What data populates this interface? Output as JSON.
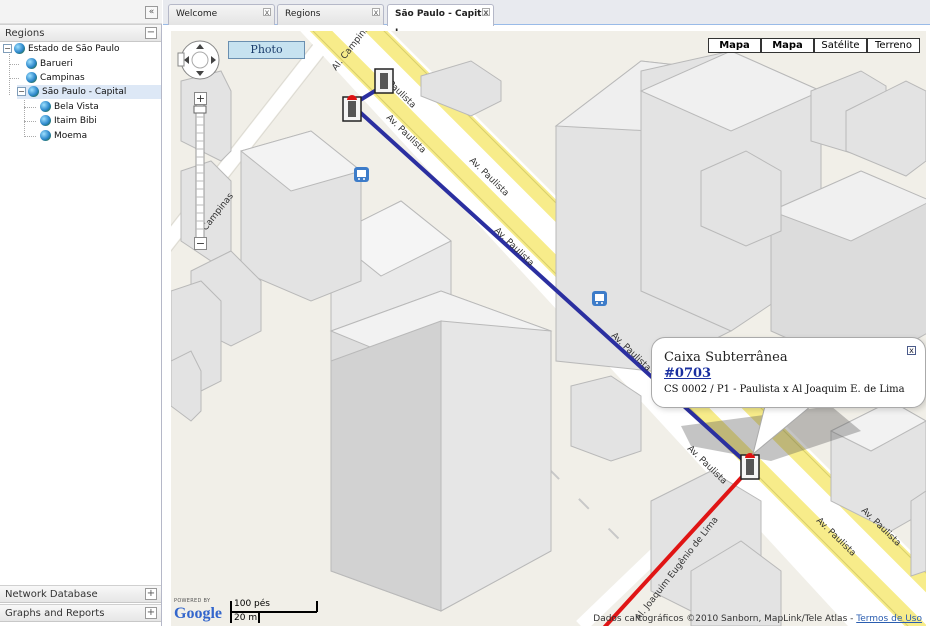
{
  "sidebar": {
    "collapse_icon": "«",
    "regions": {
      "title": "Regions",
      "toggle": "−",
      "tree": [
        {
          "label": "Estado de São Paulo",
          "toggle": "−",
          "children_expanded": true
        },
        {
          "label": "Barueri"
        },
        {
          "label": "Campinas"
        },
        {
          "label": "São Paulo - Capital",
          "toggle": "−",
          "selected": true
        },
        {
          "label": "Bela Vista"
        },
        {
          "label": "Itaim Bibi"
        },
        {
          "label": "Moema"
        }
      ]
    },
    "network_database": {
      "title": "Network Database",
      "toggle": "+"
    },
    "graphs_reports": {
      "title": "Graphs and Reports",
      "toggle": "+"
    }
  },
  "tabs": [
    {
      "label": "Welcome",
      "close": "x",
      "active": false
    },
    {
      "label": "Regions",
      "close": "x",
      "active": false
    },
    {
      "label": "São Paulo - Capital I",
      "close": "x",
      "active": true
    }
  ],
  "map": {
    "map_types": [
      "Mapa",
      "Mapa",
      "Satélite",
      "Terreno"
    ],
    "photo_button": "Photo",
    "zoom_in": "+",
    "zoom_out": "−",
    "streets": [
      {
        "label": "Av. Paulista"
      },
      {
        "label": "Av. Paulista"
      },
      {
        "label": "Av. Paulista"
      },
      {
        "label": "Av. Paulista"
      },
      {
        "label": "Av. Paulista"
      },
      {
        "label": "Av. Paulista"
      },
      {
        "label": "Av. Paulista"
      },
      {
        "label": "Av. Paulista"
      },
      {
        "label": "Al. Campinas"
      },
      {
        "label": "Campinas"
      },
      {
        "label": "Al. Joaquim Eugênio de Lima"
      }
    ],
    "popup": {
      "title": "Caixa Subterrânea",
      "link": "#0703",
      "description": "CS 0002 / P1 - Paulista x Al Joaquim E. de Lima",
      "close": "x"
    },
    "powered_by": "POWERED BY",
    "logo": "Google",
    "scale_top": "100 pés",
    "scale_bottom": "20 m",
    "attribution": "Dados cartográficos ©2010 Sanborn, MapLink/Tele Atlas - ",
    "terms_link": "Termos de Uso",
    "colors": {
      "route_blue": "#2b2fa0",
      "route_red": "#e01515",
      "road_yellow": "#f7ec8a"
    }
  }
}
